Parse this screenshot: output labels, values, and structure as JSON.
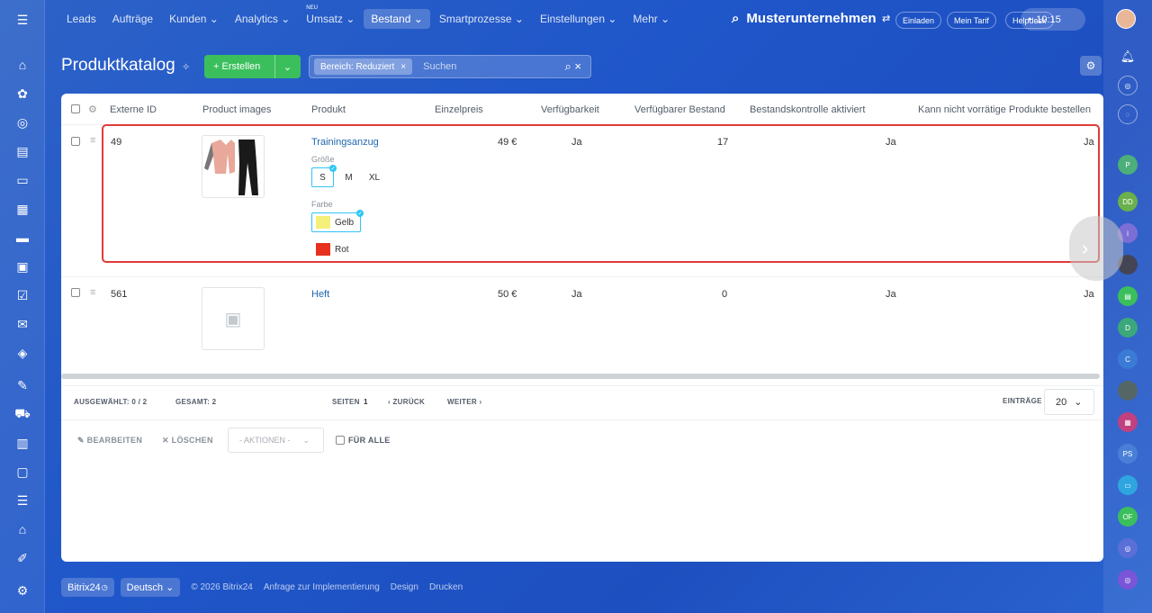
{
  "nav": {
    "items": [
      "Leads",
      "Aufträge",
      "Kunden",
      "Analytics",
      "Umsatz",
      "Bestand",
      "Smartprozesse",
      "Einstellungen",
      "Mehr"
    ],
    "new_badge": "NEU",
    "company": "Musterunternehmen",
    "invite": "Einladen",
    "tariff": "Mein Tarif",
    "helpdesk": "Helpdesk",
    "time": "10:15"
  },
  "page": {
    "title": "Produktkatalog",
    "create_label": "Erstellen",
    "filter_chip": "Bereich: Reduziert",
    "search_placeholder": "Suchen"
  },
  "table": {
    "columns": [
      "Externe ID",
      "Product images",
      "Produkt",
      "Einzelpreis",
      "Verfügbarkeit",
      "Verfügbarer Bestand",
      "Bestandskontrolle aktiviert",
      "Kann nicht vorrätige Produkte bestellen"
    ],
    "rows": [
      {
        "id": "49",
        "product": "Trainingsanzug",
        "price": "49 €",
        "availability": "Ja",
        "stock": "17",
        "control": "Ja",
        "order_oos": "Ja",
        "size_label": "Größe",
        "sizes": [
          "S",
          "M",
          "XL"
        ],
        "color_label": "Farbe",
        "colors": [
          "Gelb",
          "Rot"
        ]
      },
      {
        "id": "561",
        "product": "Heft",
        "price": "50 €",
        "availability": "Ja",
        "stock": "0",
        "control": "Ja",
        "order_oos": "Ja"
      }
    ]
  },
  "footer": {
    "selected": "AUSGEWÄHLT: 0 / 2",
    "total": "GESAMT: 2",
    "pages_label": "SEITEN",
    "page": "1",
    "back": "ZURÜCK",
    "next": "WEITER",
    "entries_label": "EINTRÄGE",
    "entries": "20"
  },
  "actions": {
    "edit": "BEARBEITEN",
    "delete": "LÖSCHEN",
    "select": "- AKTIONEN -",
    "for_all": "FÜR ALLE"
  },
  "bottom": {
    "brand": "Bitrix24",
    "language": "Deutsch",
    "copyright": "© 2026 Bitrix24",
    "links": [
      "Anfrage zur Implementierung",
      "Design",
      "Drucken"
    ]
  },
  "colors": {
    "accent": "#3bbf5c",
    "link": "#2067b0",
    "highlight": "#e03a3a",
    "swatch_yellow": "#f5f07a",
    "swatch_red": "#e8301e"
  }
}
